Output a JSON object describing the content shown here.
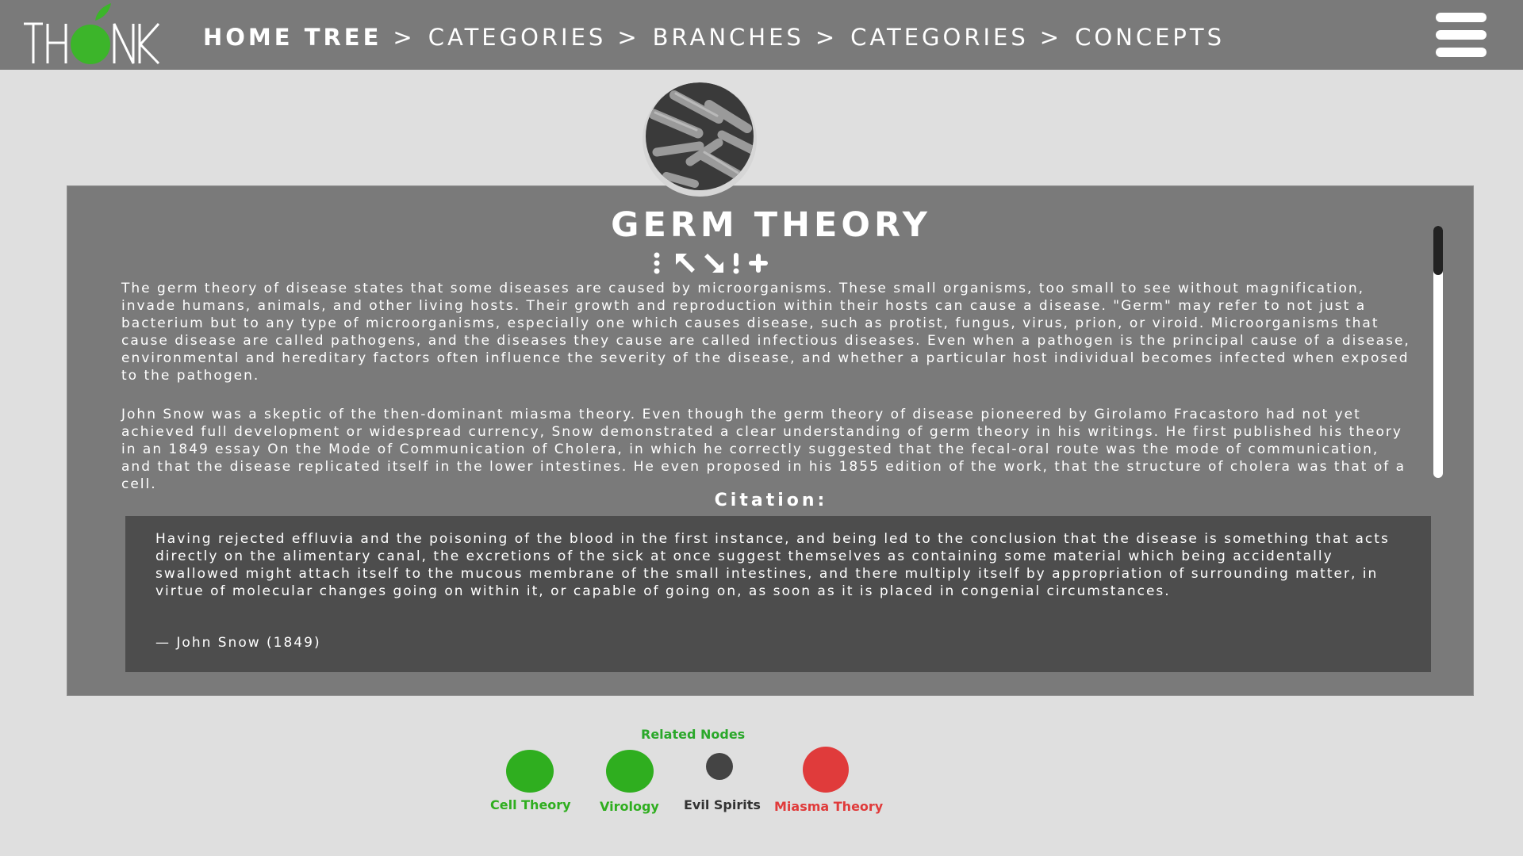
{
  "header": {
    "logo_text": "THINK",
    "breadcrumbs": [
      {
        "label": "HOME TREE"
      },
      {
        "label": "CATEGORIES"
      },
      {
        "label": "BRANCHES"
      },
      {
        "label": "CATEGORIES"
      },
      {
        "label": "CONCEPTS"
      }
    ],
    "separator": ">",
    "menu_icon": "hamburger-icon"
  },
  "concept": {
    "title": "GERM THEORY",
    "image": "bacteria-micrograph",
    "tools": [
      "more-vertical-icon",
      "arrow-up-left-icon",
      "arrow-down-right-icon",
      "exclamation-icon",
      "plus-icon"
    ],
    "paragraphs": [
      "The germ theory of disease states that some diseases are caused by microorganisms. These small organisms, too small to see without magnification, invade humans, animals, and other living hosts. Their growth and reproduction within their hosts can cause a disease. \"Germ\" may refer to not just a bacterium but to any type of microorganisms, especially one which causes disease, such as protist, fungus, virus, prion, or viroid. Microorganisms that cause disease are called pathogens, and the diseases they cause are called infectious diseases. Even when a pathogen is the principal cause of a disease, environmental and hereditary factors often influence the severity of the disease, and whether a particular host individual becomes infected when exposed to the pathogen.",
      "John Snow was a skeptic of the then-dominant miasma theory. Even though the germ theory of disease pioneered by Girolamo Fracastoro had not yet achieved full development or widespread currency, Snow demonstrated a clear understanding of germ theory in his writings. He first published his theory in an 1849 essay On the Mode of Communication of Cholera, in which he correctly suggested that the fecal-oral route was the mode of communication, and that the disease replicated itself in the lower intestines. He even proposed in his 1855 edition of the work, that the structure of cholera was that of a cell."
    ],
    "citation_heading": "Citation:",
    "citation_quote": "Having rejected effluvia and the poisoning of the blood in the first instance, and being led to the conclusion that the disease is something that acts directly on the alimentary canal, the excretions of the sick at once suggest themselves as containing some material which being accidentally swallowed might attach itself to the mucous membrane of the small intestines, and there multiply itself by appropriation of surrounding matter, in virtue of molecular changes going on within it, or capable of going on, as soon as it is placed in congenial circumstances.",
    "citation_author": "— John Snow (1849)"
  },
  "related": {
    "title": "Related Nodes",
    "nodes": [
      {
        "label": "Cell Theory",
        "color": "#2fae1f"
      },
      {
        "label": "Virology",
        "color": "#2fae1f"
      },
      {
        "label": "Evil Spirits",
        "color": "#444444"
      },
      {
        "label": "Miasma Theory",
        "color": "#e03b3b"
      }
    ]
  },
  "colors": {
    "header_bg": "#7a7a7a",
    "page_bg": "#dfdfdf",
    "card_bg": "#7a7a7a",
    "citation_bg": "#4d4d4d",
    "accent_green": "#2fae1f",
    "accent_red": "#e03b3b"
  }
}
